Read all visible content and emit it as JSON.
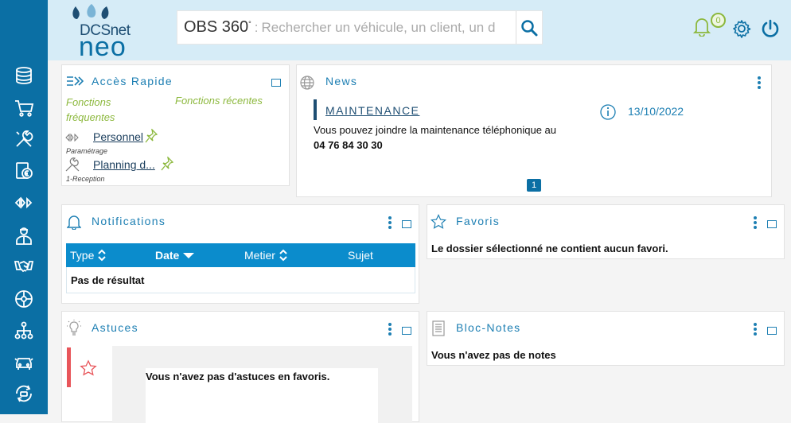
{
  "brand": {
    "name_top": "DCSnet",
    "name_bottom": "neo"
  },
  "search": {
    "prefix": "OBS 360",
    "placeholder": "Rechercher un véhicule, un client, un d"
  },
  "header": {
    "notification_count": "0"
  },
  "sidebar": {
    "items": [
      {
        "icon": "database-icon"
      },
      {
        "icon": "cart-icon"
      },
      {
        "icon": "wrench-screwdriver-icon"
      },
      {
        "icon": "invoice-euro-icon"
      },
      {
        "icon": "brand-logo-icon"
      },
      {
        "icon": "mechanic-icon"
      },
      {
        "icon": "handshake-icon"
      },
      {
        "icon": "wheel-icon"
      },
      {
        "icon": "org-chart-icon"
      },
      {
        "icon": "car-service-icon"
      },
      {
        "icon": "car-cycle-icon"
      }
    ]
  },
  "acces_rapide": {
    "title": "Accès Rapide",
    "tab_frequent": "Fonctions fréquentes",
    "tab_recent": "Fonctions récentes",
    "items": [
      {
        "label": "Personnel",
        "sub": "Paramétrage"
      },
      {
        "label": "Planning d...",
        "sub": "1-Reception"
      }
    ]
  },
  "news": {
    "title": "News",
    "headline": "MAINTENANCE",
    "date": "13/10/2022",
    "body": "Vous pouvez joindre la maintenance téléphonique au",
    "phone": "04 76 84 30 30",
    "page": "1"
  },
  "notifications": {
    "title": "Notifications",
    "columns": [
      "Type",
      "Date",
      "Metier",
      "Sujet"
    ],
    "empty": "Pas de résultat"
  },
  "favoris": {
    "title": "Favoris",
    "empty": "Le dossier sélectionné ne contient aucun favori."
  },
  "astuces": {
    "title": "Astuces",
    "empty": "Vous n'avez pas d'astuces en favoris."
  },
  "bloc_notes": {
    "title": "Bloc-Notes",
    "empty": "Vous n'avez pas de notes"
  },
  "colors": {
    "primary": "#0b6fa4",
    "accent": "#1d7fb3",
    "green": "#8cb83d",
    "header_bg": "#d6ecf7"
  }
}
